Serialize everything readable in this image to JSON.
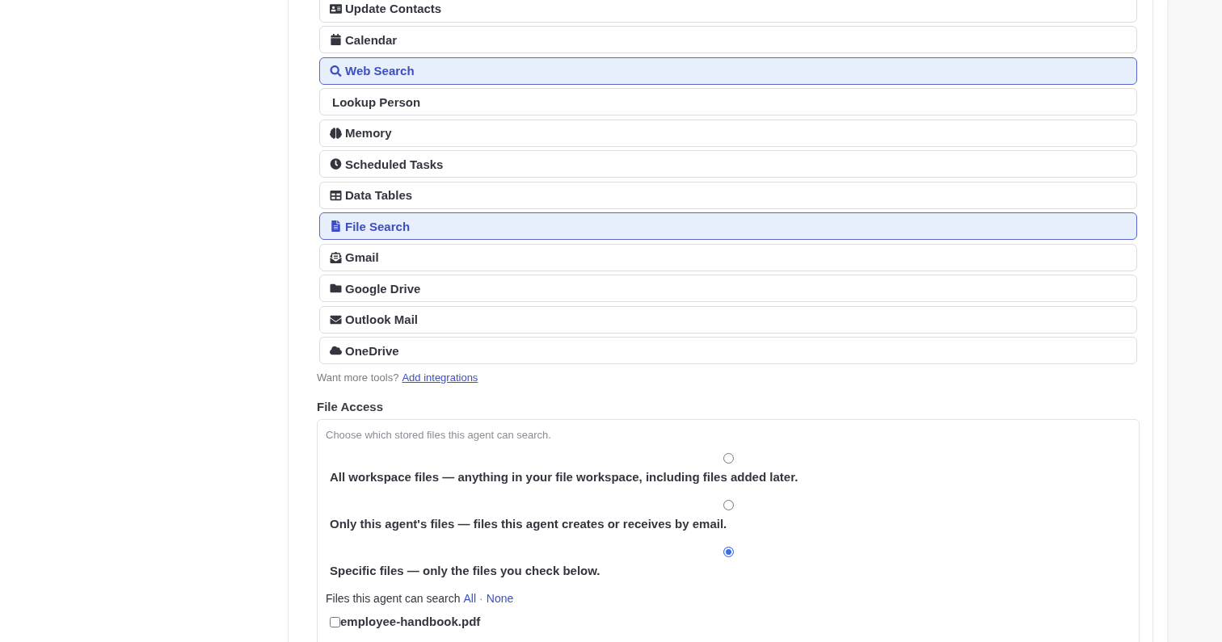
{
  "tools": [
    {
      "label": "Update Contacts",
      "selected": false
    },
    {
      "label": "Calendar",
      "selected": false
    },
    {
      "label": "Web Search",
      "selected": true
    },
    {
      "label": "Lookup Person",
      "selected": false
    },
    {
      "label": "Memory",
      "selected": false
    },
    {
      "label": "Scheduled Tasks",
      "selected": false
    },
    {
      "label": "Data Tables",
      "selected": false
    },
    {
      "label": "File Search",
      "selected": true
    },
    {
      "label": "Gmail",
      "selected": false
    },
    {
      "label": "Google Drive",
      "selected": false
    },
    {
      "label": "Outlook Mail",
      "selected": false
    },
    {
      "label": "OneDrive",
      "selected": false
    }
  ],
  "more_tools": {
    "text": "Want more tools?",
    "link": "Add integrations"
  },
  "file_access": {
    "title": "File Access",
    "hint": "Choose which stored files this agent can search.",
    "options": [
      {
        "label": "All workspace files — anything in your file workspace, including files added later.",
        "selected": false
      },
      {
        "label": "Only this agent's files — files this agent creates or receives by email.",
        "selected": false
      },
      {
        "label": "Specific files — only the files you check below.",
        "selected": true
      }
    ],
    "files_heading": "Files this agent can search",
    "select_all": "All",
    "separator": "·",
    "select_none": "None",
    "files": [
      {
        "name": "employee-handbook.pdf",
        "checked": false
      }
    ]
  }
}
